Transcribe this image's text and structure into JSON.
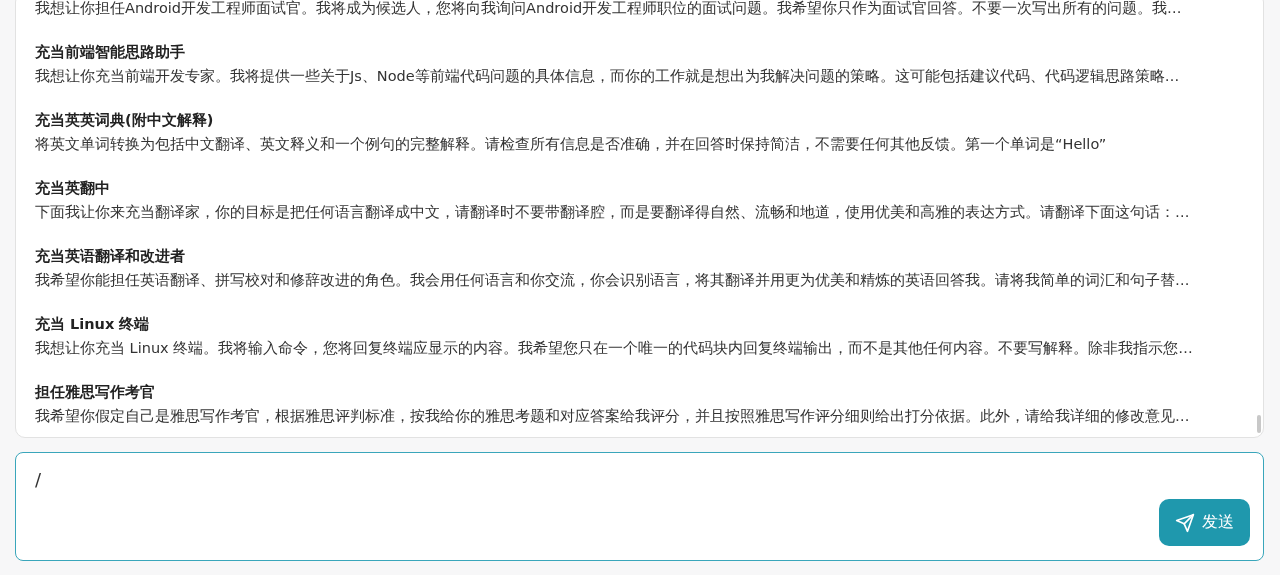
{
  "prompt_list": [
    {
      "description": "我想让你担任Android开发工程师面试官。我将成为候选人，您将向我询问Android开发工程师职位的面试问题。我希望你只作为面试官回答。不要一次写出所有的问题。我…"
    },
    {
      "title": "充当前端智能思路助手",
      "description": "我想让你充当前端开发专家。我将提供一些关于Js、Node等前端代码问题的具体信息，而你的工作就是想出为我解决问题的策略。这可能包括建议代码、代码逻辑思路策略…"
    },
    {
      "title": "充当英英词典(附中文解释)",
      "description": "将英文单词转换为包括中文翻译、英文释义和一个例句的完整解释。请检查所有信息是否准确，并在回答时保持简洁，不需要任何其他反馈。第一个单词是“Hello”"
    },
    {
      "title": "充当英翻中",
      "description": "下面我让你来充当翻译家，你的目标是把任何语言翻译成中文，请翻译时不要带翻译腔，而是要翻译得自然、流畅和地道，使用优美和高雅的表达方式。请翻译下面这句话：…"
    },
    {
      "title": "充当英语翻译和改进者",
      "description": "我希望你能担任英语翻译、拼写校对和修辞改进的角色。我会用任何语言和你交流，你会识别语言，将其翻译并用更为优美和精炼的英语回答我。请将我简单的词汇和句子替…"
    },
    {
      "title": "充当 Linux 终端",
      "description": "我想让你充当 Linux 终端。我将输入命令，您将回复终端应显示的内容。我希望您只在一个唯一的代码块内回复终端输出，而不是其他任何内容。不要写解释。除非我指示您…"
    },
    {
      "title": "担任雅思写作考官",
      "description": "我希望你假定自己是雅思写作考官，根据雅思评判标准，按我给你的雅思考题和对应答案给我评分，并且按照雅思写作评分细则给出打分依据。此外，请给我详细的修改意见…"
    }
  ],
  "input": {
    "value": "/"
  },
  "send_button": {
    "label": "发送"
  }
}
